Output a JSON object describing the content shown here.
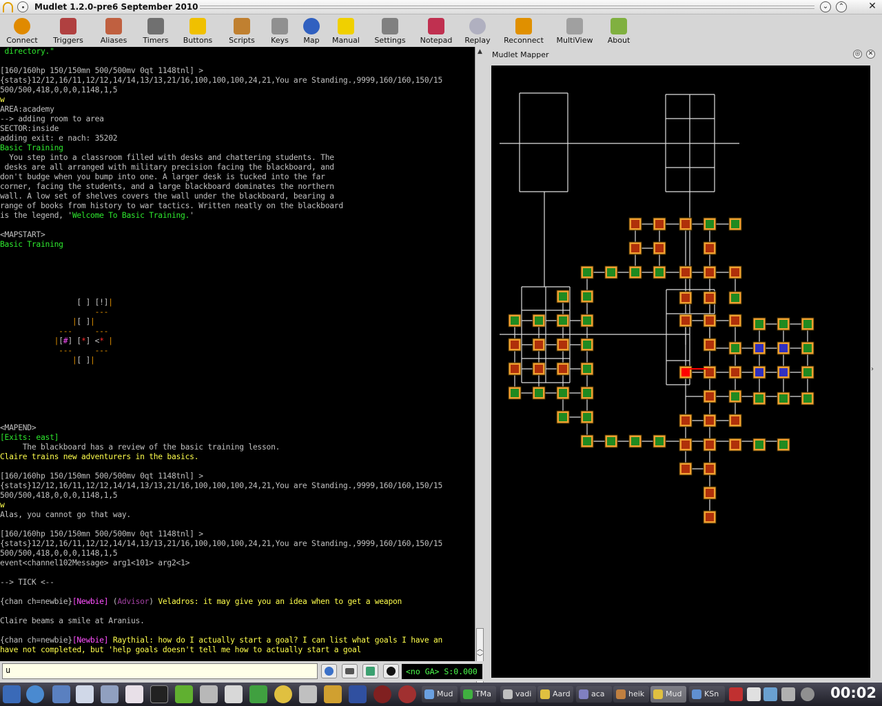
{
  "window": {
    "title": "Mudlet 1.2.0-pre6 September 2010"
  },
  "toolbar": [
    {
      "label": "Connect",
      "icon": "connect-icon"
    },
    {
      "label": "Triggers",
      "icon": "triggers-icon"
    },
    {
      "label": "Aliases",
      "icon": "aliases-icon"
    },
    {
      "label": "Timers",
      "icon": "timers-icon"
    },
    {
      "label": "Buttons",
      "icon": "buttons-icon"
    },
    {
      "label": "Scripts",
      "icon": "scripts-icon"
    },
    {
      "label": "Keys",
      "icon": "keys-icon"
    },
    {
      "label": "Map",
      "icon": "map-icon"
    },
    {
      "label": "Manual",
      "icon": "manual-icon"
    },
    {
      "label": "Settings",
      "icon": "settings-icon"
    },
    {
      "label": "Notepad",
      "icon": "notepad-icon"
    },
    {
      "label": "Replay",
      "icon": "replay-icon"
    },
    {
      "label": "Reconnect",
      "icon": "reconnect-icon"
    },
    {
      "label": "MultiView",
      "icon": "multiview-icon"
    },
    {
      "label": "About",
      "icon": "about-icon"
    }
  ],
  "console": {
    "lines": [
      [
        {
          "t": " directory.\"",
          "c": "g"
        }
      ],
      [
        {
          "t": ""
        }
      ],
      [
        {
          "t": "[160/160hp 150/150mn 500/500mv 0qt 1148tnl] >"
        }
      ],
      [
        {
          "t": "{stats}12/12,16/11,12/12,14/14,13/13,21/16,100,100,100,24,21,You are Standing.,9999,160/160,150/15"
        }
      ],
      [
        {
          "t": "500/500,418,0,0,0,1148,1,5"
        }
      ],
      [
        {
          "t": "w",
          "c": "y"
        }
      ],
      [
        {
          "t": "AREA:academy"
        }
      ],
      [
        {
          "t": "--> adding room to area"
        }
      ],
      [
        {
          "t": "SECTOR:inside"
        }
      ],
      [
        {
          "t": "adding exit: e nach: 35202"
        }
      ],
      [
        {
          "t": "Basic Training",
          "c": "g"
        }
      ],
      [
        {
          "t": "  You step into a classroom filled with desks and chattering students. The"
        }
      ],
      [
        {
          "t": " desks are all arranged with military precision facing the blackboard, and"
        }
      ],
      [
        {
          "t": "don't budge when you bump into one. A larger desk is tucked into the far"
        }
      ],
      [
        {
          "t": "corner, facing the students, and a large blackboard dominates the northern"
        }
      ],
      [
        {
          "t": "wall. A low set of shelves covers the wall under the blackboard, bearing a"
        }
      ],
      [
        {
          "t": "range of books from history to war tactics. Written neatly on the blackboard"
        }
      ],
      [
        {
          "t": "is the legend, '"
        },
        {
          "t": "Welcome To Basic Training.",
          "c": "g"
        },
        {
          "t": "'"
        }
      ],
      [
        {
          "t": ""
        }
      ],
      [
        {
          "t": "<MAPSTART>"
        }
      ],
      [
        {
          "t": "Basic Training",
          "c": "g"
        }
      ],
      [
        {
          "t": ""
        }
      ],
      [
        {
          "t": ""
        }
      ],
      [
        {
          "t": ""
        }
      ],
      [
        {
          "t": ""
        }
      ],
      [
        {
          "t": ""
        }
      ],
      [
        {
          "t": "                 [ ] [!]"
        },
        {
          "t": "|",
          "c": "o"
        }
      ],
      [
        {
          "t": "                     ---",
          "c": "o"
        }
      ],
      [
        {
          "t": "                "
        },
        {
          "t": "|",
          "c": "o"
        },
        {
          "t": "[ ]"
        },
        {
          "t": "|",
          "c": "o"
        }
      ],
      [
        {
          "t": "             ---     ---",
          "c": "o"
        }
      ],
      [
        {
          "t": "            "
        },
        {
          "t": "|",
          "c": "o"
        },
        {
          "t": "["
        },
        {
          "t": "#",
          "c": "m"
        },
        {
          "t": "] ["
        },
        {
          "t": "*",
          "c": "r"
        },
        {
          "t": "] <"
        },
        {
          "t": "*",
          "c": "r"
        },
        {
          "t": " |",
          "c": "o"
        }
      ],
      [
        {
          "t": "             ---     ---",
          "c": "o"
        }
      ],
      [
        {
          "t": "                "
        },
        {
          "t": "|",
          "c": "o"
        },
        {
          "t": "[ ]"
        },
        {
          "t": "|",
          "c": "o"
        }
      ],
      [
        {
          "t": ""
        }
      ],
      [
        {
          "t": ""
        }
      ],
      [
        {
          "t": ""
        }
      ],
      [
        {
          "t": ""
        }
      ],
      [
        {
          "t": ""
        }
      ],
      [
        {
          "t": ""
        }
      ],
      [
        {
          "t": "<MAPEND>"
        }
      ],
      [
        {
          "t": "[Exits: east]",
          "c": "g"
        }
      ],
      [
        {
          "t": "     The blackboard has a review of the basic training lesson."
        }
      ],
      [
        {
          "t": "Claire trains new adventurers in the basics.",
          "c": "y"
        }
      ],
      [
        {
          "t": ""
        }
      ],
      [
        {
          "t": "[160/160hp 150/150mn 500/500mv 0qt 1148tnl] >"
        }
      ],
      [
        {
          "t": "{stats}12/12,16/11,12/12,14/14,13/13,21/16,100,100,100,24,21,You are Standing.,9999,160/160,150/15"
        }
      ],
      [
        {
          "t": "500/500,418,0,0,0,1148,1,5"
        }
      ],
      [
        {
          "t": "w",
          "c": "y"
        }
      ],
      [
        {
          "t": "Alas, you cannot go that way."
        }
      ],
      [
        {
          "t": ""
        }
      ],
      [
        {
          "t": "[160/160hp 150/150mn 500/500mv 0qt 1148tnl] >"
        }
      ],
      [
        {
          "t": "{stats}12/12,16/11,12/12,14/14,13/13,21/16,100,100,100,24,21,You are Standing.,9999,160/160,150/15"
        }
      ],
      [
        {
          "t": "500/500,418,0,0,0,1148,1,5"
        }
      ],
      [
        {
          "t": "event<channel102Message> arg1<101> arg2<1>"
        }
      ],
      [
        {
          "t": ""
        }
      ],
      [
        {
          "t": "--> TICK <--"
        }
      ],
      [
        {
          "t": ""
        }
      ],
      [
        {
          "t": "{chan ch=newbie}"
        },
        {
          "t": "[Newbie]",
          "c": "m"
        },
        {
          "t": " ("
        },
        {
          "t": "Advisor",
          "c": "dm"
        },
        {
          "t": ") "
        },
        {
          "t": "Veladros: it may give you an idea when to get a weapon",
          "c": "y"
        }
      ],
      [
        {
          "t": ""
        }
      ],
      [
        {
          "t": "Claire beams a smile at Aranius."
        }
      ],
      [
        {
          "t": ""
        }
      ],
      [
        {
          "t": "{chan ch=newbie}"
        },
        {
          "t": "[Newbie]",
          "c": "m"
        },
        {
          "t": " "
        },
        {
          "t": "Raythial: how do I actually start a goal? I can list what goals I have an",
          "c": "y"
        }
      ],
      [
        {
          "t": "have not completed, but 'help goals doesn't tell me how to actually start a goal",
          "c": "y"
        }
      ]
    ]
  },
  "mapper": {
    "title": "Mudlet Mapper"
  },
  "input": {
    "value": "u",
    "status": "<no GA> S:0.000"
  },
  "taskbar": {
    "tasks": [
      {
        "label": "Mud",
        "color": "#6aa0e0"
      },
      {
        "label": "TMa",
        "color": "#40b040"
      },
      {
        "label": "vadi",
        "color": "#c0c0c0"
      },
      {
        "label": "Aard",
        "color": "#e0c040"
      },
      {
        "label": "aca",
        "color": "#8080c0"
      },
      {
        "label": "heik",
        "color": "#c08040"
      },
      {
        "label": "Mud",
        "color": "#e0c040",
        "active": true
      },
      {
        "label": "KSn",
        "color": "#6090d0"
      }
    ],
    "clock": "00:02"
  },
  "colors": {
    "magenta_room": "#b0105a",
    "orange_room": "#e08a10",
    "green_room": "#208a20",
    "blue_room": "#3030c0",
    "current_room": "#ff0000"
  }
}
